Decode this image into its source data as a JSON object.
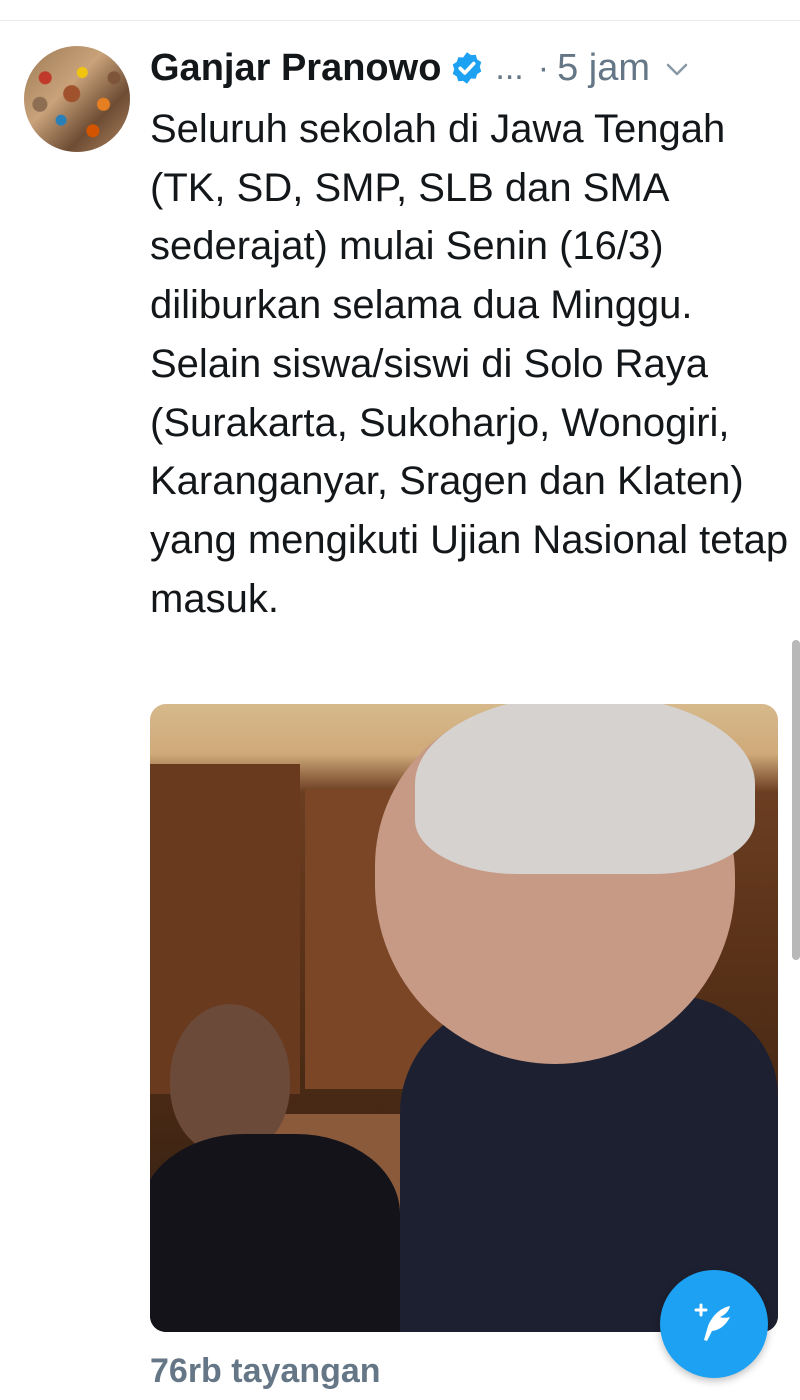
{
  "tweet": {
    "author_name": "Ganjar Pranowo",
    "handle": "...",
    "separator": "·",
    "time": "5 jam",
    "text": "Seluruh sekolah di Jawa Tengah (TK, SD, SMP, SLB dan SMA sederajat) mulai Senin (16/3) diliburkan selama dua Minggu. Selain siswa/siswi di Solo Raya (Surakarta, Sukoharjo, Wonogiri, Karanganyar, Sragen dan Klaten) yang mengikuti Ujian Nasional tetap masuk.",
    "views": "76rb tayangan"
  },
  "icons": {
    "verified": "verified-badge-icon",
    "chevron": "chevron-down-icon",
    "compose": "compose-tweet-icon"
  },
  "colors": {
    "accent": "#1da1f2",
    "secondary_text": "#657786",
    "primary_text": "#14171a"
  }
}
